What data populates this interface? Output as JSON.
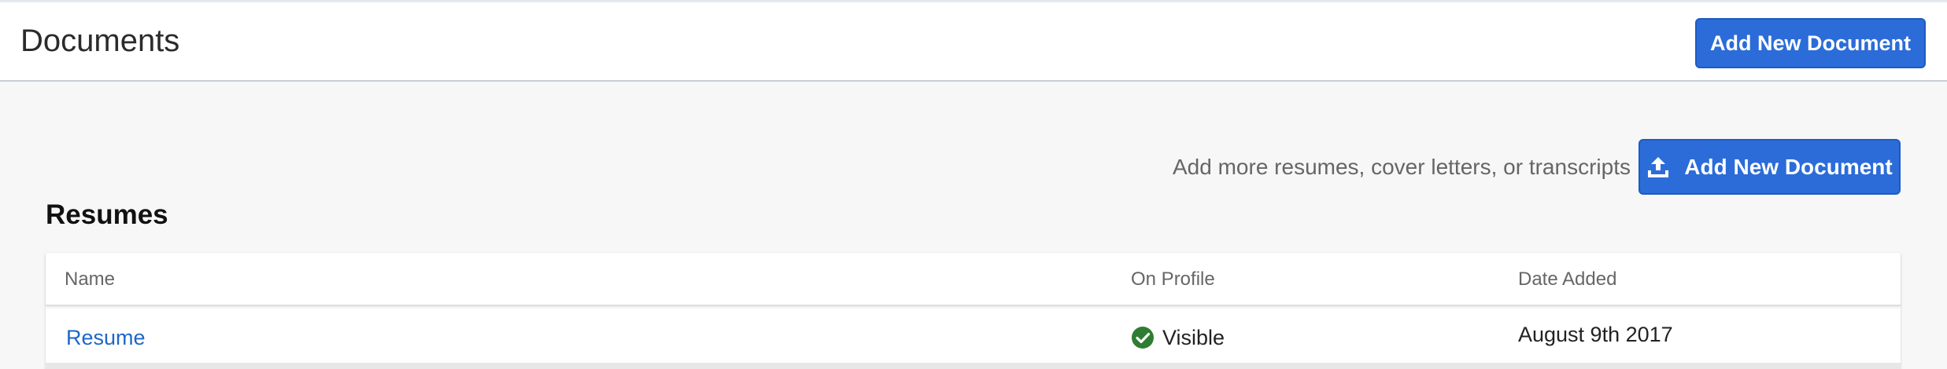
{
  "header": {
    "title": "Documents",
    "add_button_label": "Add New Document"
  },
  "toolbar": {
    "helper_text": "Add more resumes, cover letters, or transcripts",
    "add_button_label": "Add New Document",
    "add_button_icon": "upload-icon"
  },
  "resumes": {
    "section_title": "Resumes",
    "columns": [
      "Name",
      "On Profile",
      "Date Added"
    ],
    "rows": [
      {
        "name": "Resume",
        "on_profile": "Visible",
        "on_profile_icon": "check-circle-icon",
        "date_added": "August 9th 2017"
      }
    ]
  },
  "colors": {
    "primary": "#2b6cd9",
    "link": "#1f66c8",
    "success": "#2e7d32",
    "background": "#f7f7f7"
  }
}
